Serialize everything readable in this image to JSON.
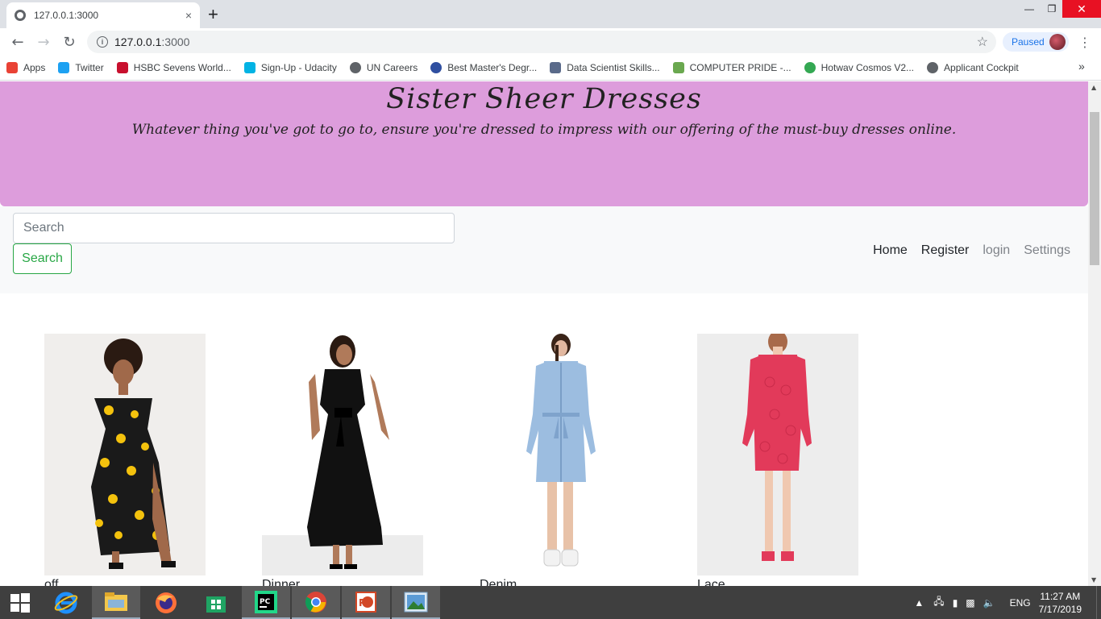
{
  "browser": {
    "tab_title": "127.0.0.1:3000",
    "tab_close": "×",
    "new_tab": "+",
    "url_host": "127.0.0.1",
    "url_port": ":3000",
    "profile_status": "Paused"
  },
  "bookmarks": [
    {
      "label": "Apps",
      "icon": "apps-grid-icon",
      "color": "#e94235"
    },
    {
      "label": "Twitter",
      "icon": "twitter-icon",
      "color": "#1da1f2"
    },
    {
      "label": "HSBC Sevens World...",
      "icon": "hsbc-icon",
      "color": "#c8102e"
    },
    {
      "label": "Sign-Up - Udacity",
      "icon": "udacity-icon",
      "color": "#02b3e4"
    },
    {
      "label": "UN Careers",
      "icon": "globe-icon",
      "color": "#5f6368"
    },
    {
      "label": "Best Master's Degr...",
      "icon": "globe-icon",
      "color": "#2f4fa0"
    },
    {
      "label": "Data Scientist Skills...",
      "icon": "gear-icon",
      "color": "#5a6a8a"
    },
    {
      "label": "COMPUTER PRIDE -...",
      "icon": "computer-pride-icon",
      "color": "#6aa84f"
    },
    {
      "label": "Hotwav Cosmos V2...",
      "icon": "hotwav-icon",
      "color": "#34a853"
    },
    {
      "label": "Applicant Cockpit",
      "icon": "globe-icon",
      "color": "#5f6368"
    }
  ],
  "site": {
    "title": "Sister Sheer Dresses",
    "tagline": "Whatever thing you've got to go to, ensure you're dressed to impress with our offering of the must-buy dresses online.",
    "accent_color": "#dd9ddc"
  },
  "search": {
    "placeholder": "Search",
    "button_label": "Search"
  },
  "nav": {
    "home": "Home",
    "register": "Register",
    "login": "login",
    "settings": "Settings"
  },
  "products": [
    {
      "name": "off...",
      "image": "sunflower-print-dress"
    },
    {
      "name": "Dinner",
      "image": "black-dinner-dress"
    },
    {
      "name": "Denim",
      "image": "denim-shirt-dress"
    },
    {
      "name": "Lace",
      "image": "pink-lace-dress"
    }
  ],
  "taskbar": {
    "language": "ENG",
    "time": "11:27 AM",
    "date": "7/17/2019"
  }
}
